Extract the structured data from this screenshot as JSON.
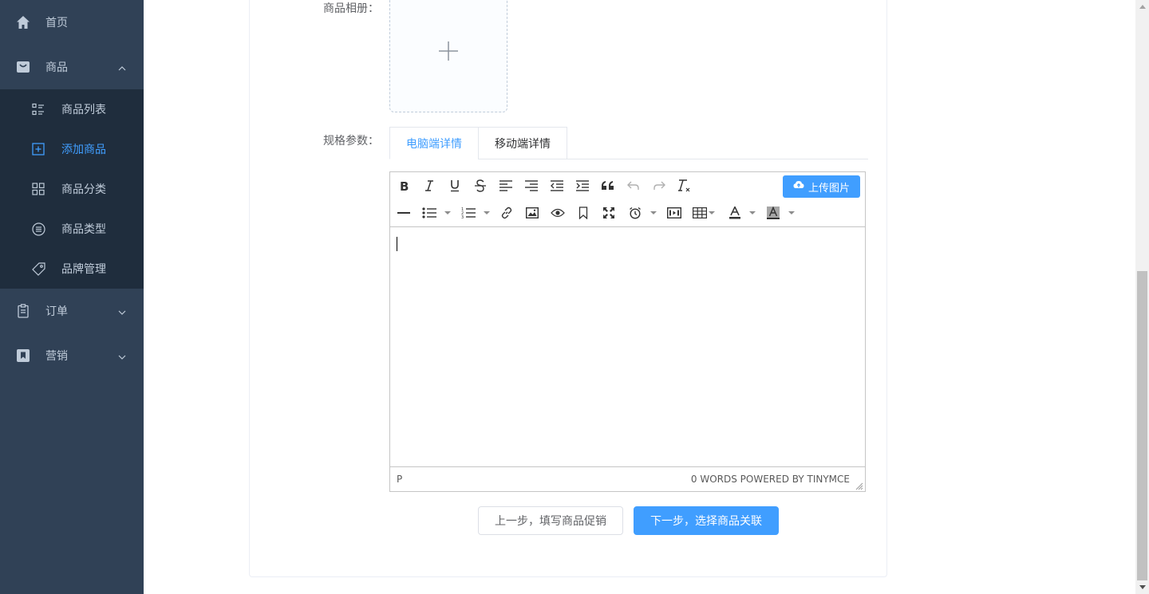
{
  "sidebar": {
    "home": {
      "label": "首页",
      "icon": "home-icon"
    },
    "goods": {
      "label": "商品",
      "icon": "shopping-bag-icon",
      "expanded": true
    },
    "goods_items": [
      {
        "label": "商品列表",
        "icon": "list-icon",
        "active": false
      },
      {
        "label": "添加商品",
        "icon": "add-square-icon",
        "active": true
      },
      {
        "label": "商品分类",
        "icon": "grid-icon",
        "active": false
      },
      {
        "label": "商品类型",
        "icon": "list-circle-icon",
        "active": false
      },
      {
        "label": "品牌管理",
        "icon": "tag-icon",
        "active": false
      }
    ],
    "orders": {
      "label": "订单",
      "icon": "clipboard-icon"
    },
    "marketing": {
      "label": "营销",
      "icon": "bookmark-icon"
    },
    "colors": {
      "bg": "#304156",
      "submenu_bg": "#1f2d3d",
      "text": "#bfcbd9",
      "active": "#409eff"
    }
  },
  "form": {
    "album_label": "商品相册：",
    "spec_label": "规格参数："
  },
  "tabs": [
    {
      "label": "电脑端详情",
      "active": true
    },
    {
      "label": "移动端详情",
      "active": false
    }
  ],
  "editor": {
    "upload_label": "上传图片",
    "status_path": "P",
    "status_right": "0 WORDS POWERED BY TINYMCE",
    "toolbar_row1": [
      "bold-icon",
      "italic-icon",
      "underline-icon",
      "strikethrough-icon",
      "align-left-icon",
      "align-right-icon",
      "outdent-icon",
      "indent-icon",
      "blockquote-icon",
      "undo-icon",
      "redo-icon",
      "clear-format-icon"
    ],
    "toolbar_row2": [
      "horizontal-rule-icon",
      "bullet-list-icon",
      "numbered-list-icon",
      "link-icon",
      "image-icon",
      "preview-icon",
      "anchor-icon",
      "fullscreen-icon",
      "datetime-icon",
      "media-icon",
      "table-icon",
      "text-color-icon",
      "background-color-icon"
    ]
  },
  "buttons": {
    "prev": "上一步，填写商品促销",
    "next": "下一步，选择商品关联"
  },
  "colors": {
    "primary": "#409eff",
    "border": "#dcdfe6"
  }
}
